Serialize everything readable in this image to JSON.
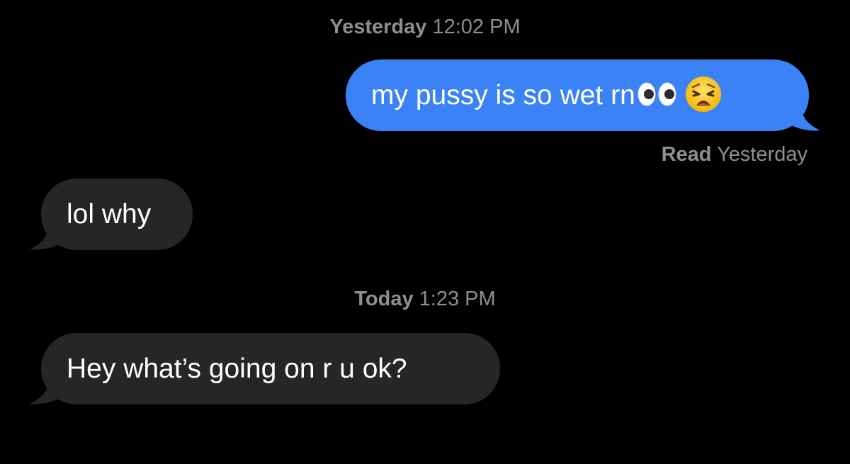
{
  "conversation": {
    "timestamps": [
      {
        "day": "Yesterday",
        "time": "12:02 PM"
      },
      {
        "day": "Today",
        "time": "1:23 PM"
      }
    ],
    "messages": [
      {
        "direction": "sent",
        "text": "my pussy is so wet rn",
        "emojis": [
          "eyes-icon",
          "weary-face-icon"
        ]
      },
      {
        "direction": "received",
        "text": "lol why"
      },
      {
        "direction": "received",
        "text": "Hey what’s going on r u ok?"
      }
    ],
    "read_receipt": {
      "label": "Read",
      "when": "Yesterday"
    }
  },
  "colors": {
    "background": "#000000",
    "sent_bubble": "#3b82f6",
    "received_bubble": "#262628",
    "meta_text": "#8e8e93",
    "bubble_text": "#ffffff"
  }
}
